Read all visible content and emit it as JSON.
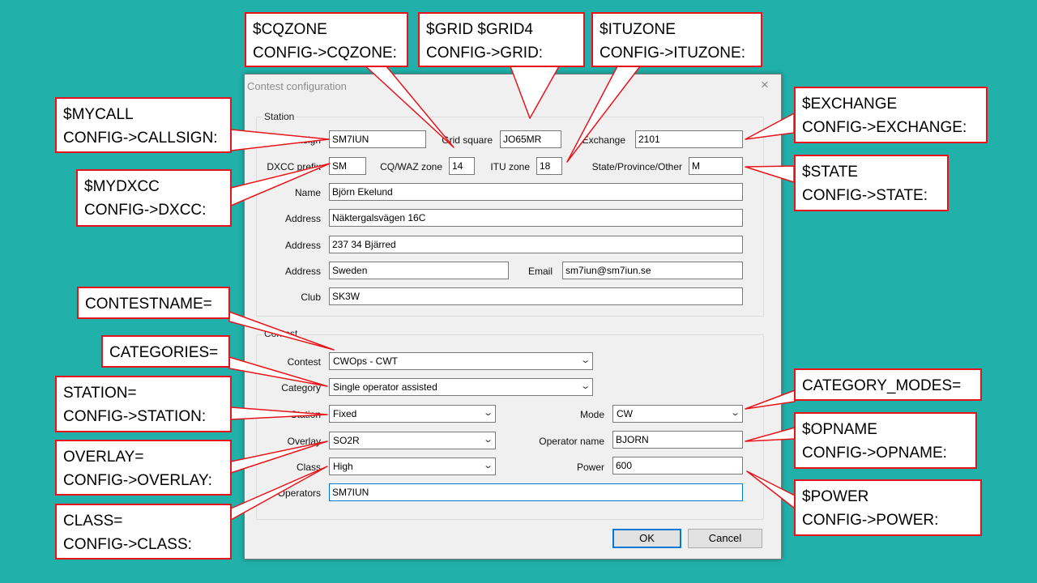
{
  "dialog": {
    "title": "Contest configuration",
    "close_symbol": "×",
    "station_group_label": "Station",
    "contest_group_label": "Contest",
    "fields": {
      "callsign": {
        "label": "Callsign",
        "value": "SM7IUN"
      },
      "grid_square": {
        "label": "Grid square",
        "value": "JO65MR"
      },
      "exchange": {
        "label": "Exchange",
        "value": "2101"
      },
      "dxcc_prefix": {
        "label": "DXCC prefix",
        "value": "SM"
      },
      "cq_waz_zone": {
        "label": "CQ/WAZ zone",
        "value": "14"
      },
      "itu_zone": {
        "label": "ITU zone",
        "value": "18"
      },
      "state": {
        "label": "State/Province/Other",
        "value": "M"
      },
      "name": {
        "label": "Name",
        "value": "Björn Ekelund"
      },
      "address1": {
        "label": "Address",
        "value": "Näktergalsvägen 16C"
      },
      "address2": {
        "label": "Address",
        "value": "237 34 Bjärred"
      },
      "address3": {
        "label": "Address",
        "value": "Sweden"
      },
      "email": {
        "label": "Email",
        "value": "sm7iun@sm7iun.se"
      },
      "club": {
        "label": "Club",
        "value": "SK3W"
      },
      "contest": {
        "label": "Contest",
        "value": "CWOps - CWT"
      },
      "category": {
        "label": "Category",
        "value": "Single operator assisted"
      },
      "station": {
        "label": "Station",
        "value": "Fixed"
      },
      "mode": {
        "label": "Mode",
        "value": "CW"
      },
      "overlay": {
        "label": "Overlay",
        "value": "SO2R"
      },
      "operator_name": {
        "label": "Operator name",
        "value": "BJORN"
      },
      "class": {
        "label": "Class",
        "value": "High"
      },
      "power": {
        "label": "Power",
        "value": "600"
      },
      "operators": {
        "label": "Operators",
        "value": "SM7IUN"
      }
    },
    "ok_label": "OK",
    "cancel_label": "Cancel"
  },
  "callouts": {
    "cqzone": [
      "$CQZONE",
      "CONFIG->CQZONE:"
    ],
    "grid": [
      "$GRID $GRID4",
      "CONFIG->GRID:"
    ],
    "ituzone": [
      "$ITUZONE",
      "CONFIG->ITUZONE:"
    ],
    "mycall": [
      "$MYCALL",
      "CONFIG->CALLSIGN:"
    ],
    "exchange": [
      "$EXCHANGE",
      "CONFIG->EXCHANGE:"
    ],
    "mydxcc": [
      "$MYDXCC",
      "CONFIG->DXCC:"
    ],
    "state": [
      "$STATE",
      "CONFIG->STATE:"
    ],
    "contestname": [
      "CONTESTNAME="
    ],
    "categories": [
      "CATEGORIES="
    ],
    "category_modes": [
      "CATEGORY_MODES="
    ],
    "station": [
      "STATION=",
      "CONFIG->STATION:"
    ],
    "opname": [
      "$OPNAME",
      "CONFIG->OPNAME:"
    ],
    "overlay": [
      "OVERLAY=",
      "CONFIG->OVERLAY:"
    ],
    "power": [
      "$POWER",
      "CONFIG->POWER:"
    ],
    "class": [
      "CLASS=",
      "CONFIG->CLASS:"
    ]
  },
  "colors": {
    "background": "#21b1aa",
    "callout_border": "#e8141b",
    "focus": "#0078d7"
  },
  "icons": {
    "close": "close-icon",
    "dropdown": "chevron-down-icon"
  }
}
